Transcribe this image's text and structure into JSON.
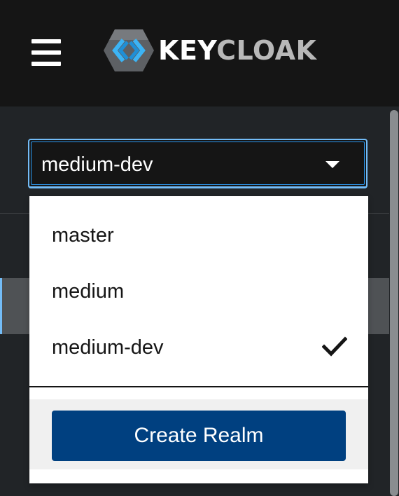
{
  "header": {
    "brand_part1": "KEY",
    "brand_part2": "CLOAK",
    "menu_icon": "hamburger-icon",
    "logo_icon": "keycloak-logo-icon"
  },
  "realm_selector": {
    "selected": "medium-dev",
    "caret_icon": "caret-down-icon",
    "options": [
      {
        "label": "master",
        "selected": false
      },
      {
        "label": "medium",
        "selected": false
      },
      {
        "label": "medium-dev",
        "selected": true
      }
    ],
    "selected_icon": "check-icon",
    "create_label": "Create Realm"
  },
  "colors": {
    "header_bg": "#151515",
    "sidebar_bg": "#212427",
    "focus_border": "#73bcf7",
    "primary_button": "#004080",
    "active_nav": "#4f5255"
  }
}
